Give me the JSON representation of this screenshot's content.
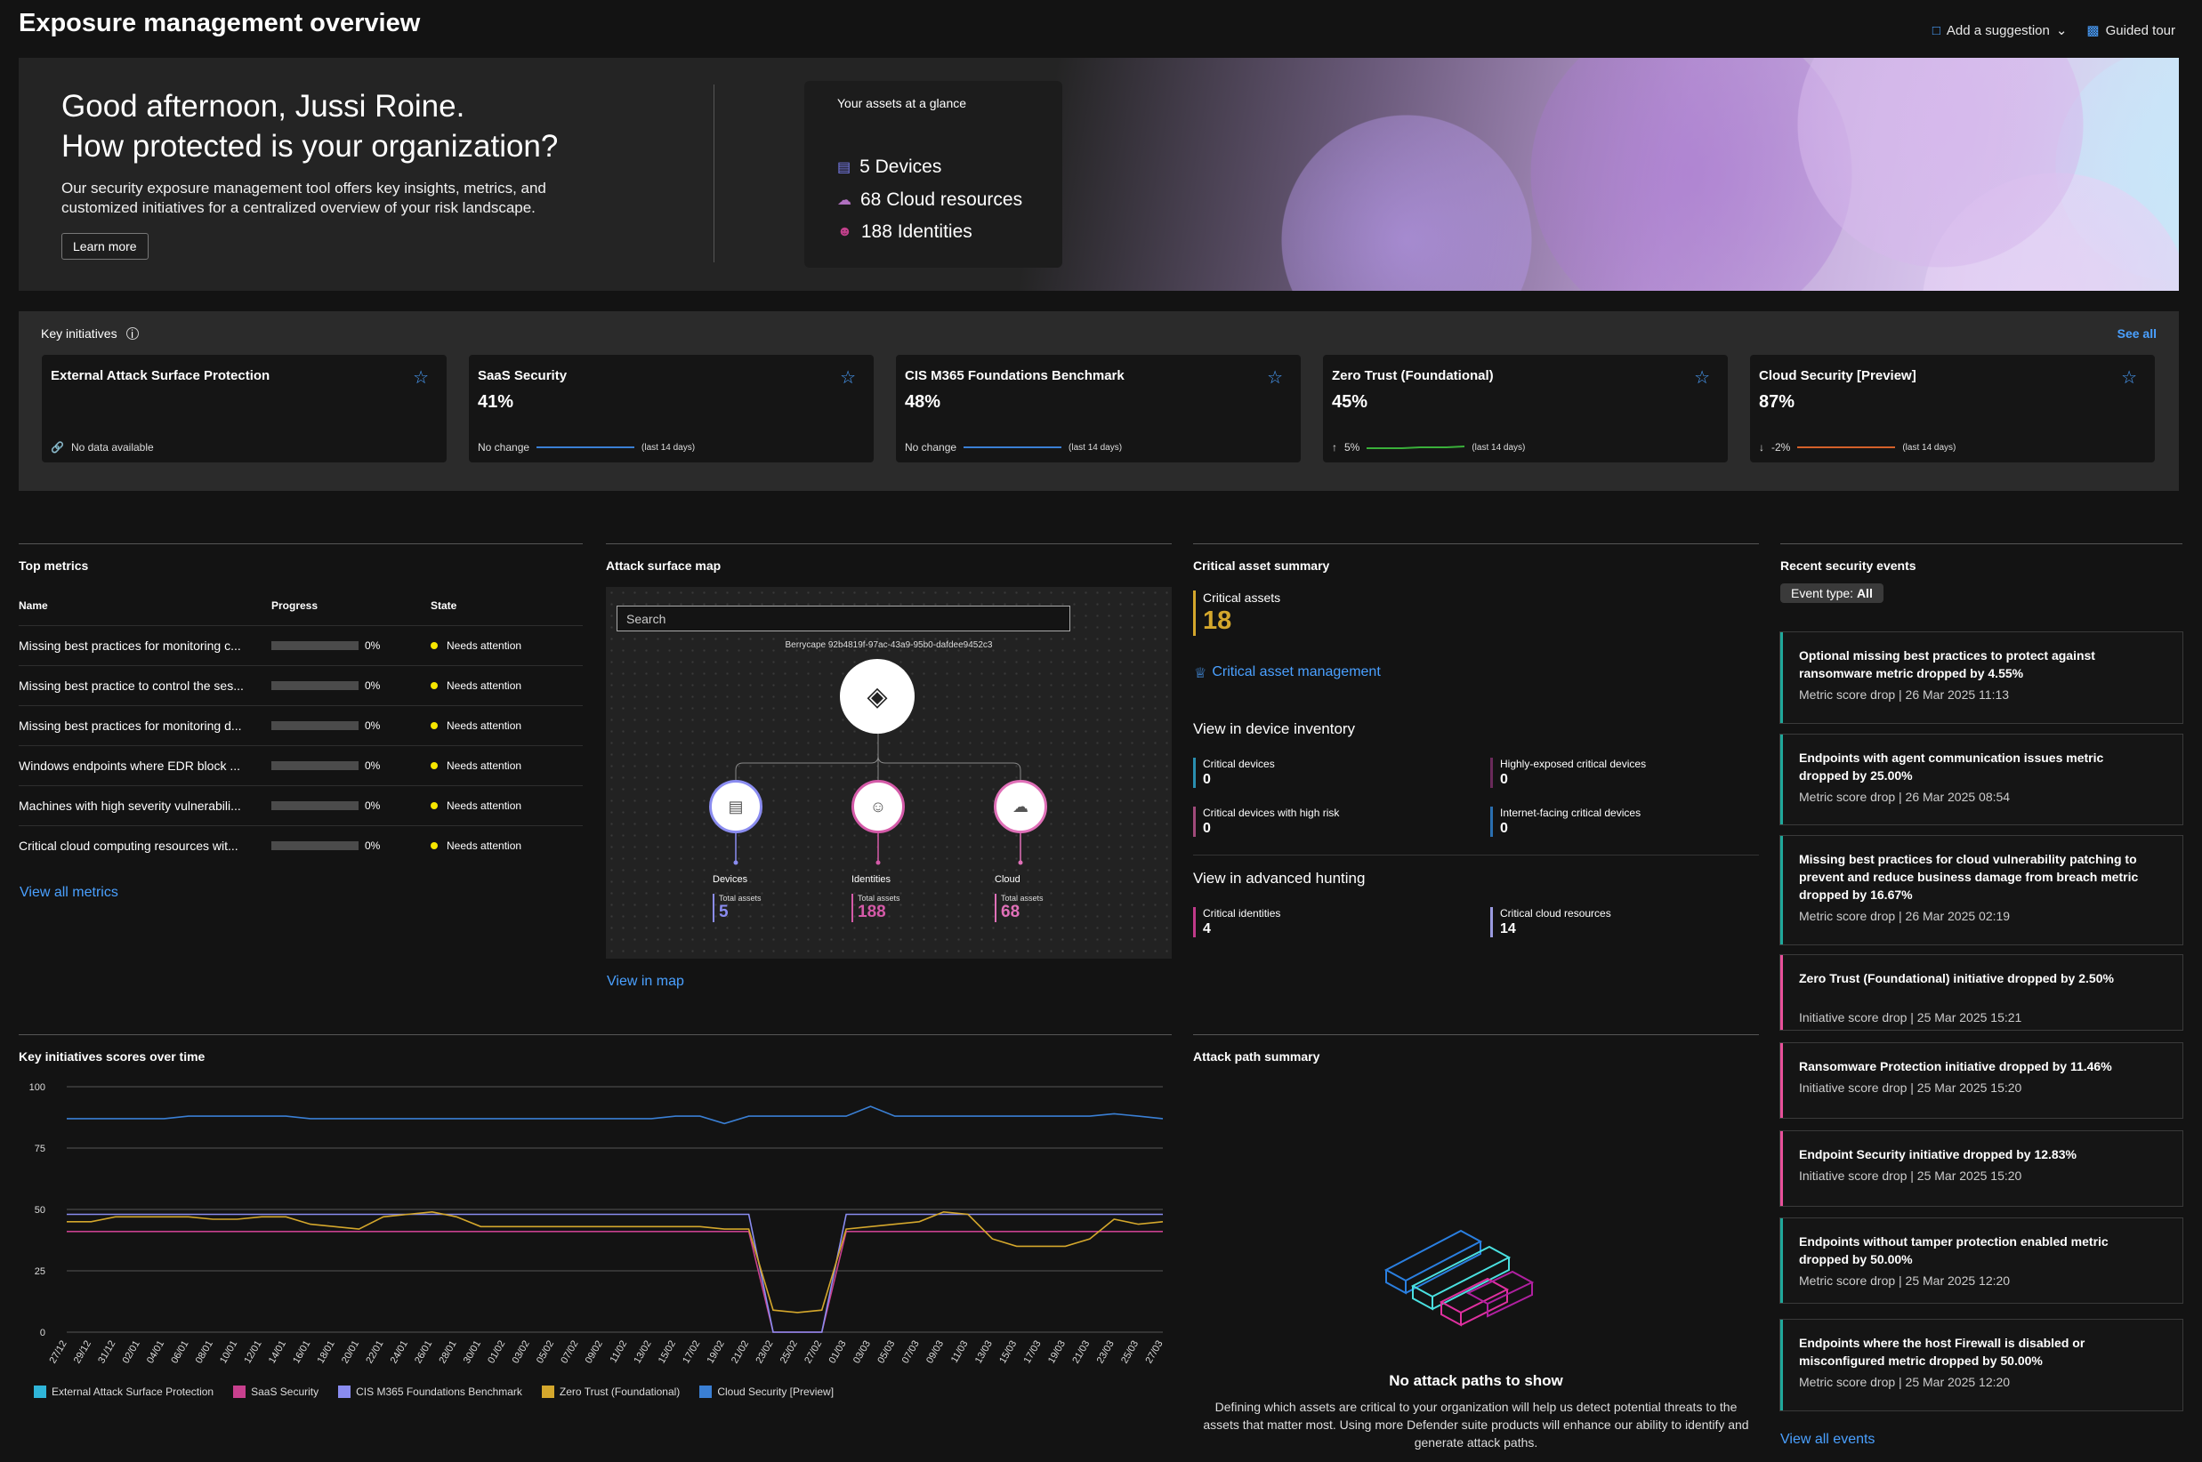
{
  "header": {
    "title": "Exposure management overview",
    "add_suggestion": "Add a suggestion",
    "guided_tour": "Guided tour"
  },
  "hero": {
    "greeting_line1": "Good afternoon, Jussi Roine.",
    "greeting_line2": "How protected is your organization?",
    "description": "Our security exposure management tool offers key insights, metrics, and customized initiatives for a centralized overview of your risk landscape.",
    "learn_more": "Learn more",
    "glance": {
      "title": "Your assets at a glance",
      "devices": "5  Devices",
      "cloud": "68  Cloud resources",
      "identities": "188  Identities"
    }
  },
  "key_initiatives": {
    "title": "Key initiatives",
    "see_all": "See all",
    "cards": [
      {
        "name": "External Attack Surface Protection",
        "pct": "",
        "change": "No data available",
        "period": ""
      },
      {
        "name": "SaaS Security",
        "pct": "41%",
        "change": "No change",
        "period": "(last 14 days)"
      },
      {
        "name": "CIS M365 Foundations Benchmark",
        "pct": "48%",
        "change": "No change",
        "period": "(last 14 days)"
      },
      {
        "name": "Zero Trust (Foundational)",
        "pct": "45%",
        "change": "5%",
        "period": "(last 14 days)"
      },
      {
        "name": "Cloud Security [Preview]",
        "pct": "87%",
        "change": "-2%",
        "period": "(last 14 days)"
      }
    ]
  },
  "top_metrics": {
    "title": "Top metrics",
    "col_name": "Name",
    "col_progress": "Progress",
    "col_state": "State",
    "rows": [
      {
        "name": "Missing best practices for monitoring c...",
        "progress": "0%",
        "state": "Needs attention"
      },
      {
        "name": "Missing best practice to control the ses...",
        "progress": "0%",
        "state": "Needs attention"
      },
      {
        "name": "Missing best practices for monitoring d...",
        "progress": "0%",
        "state": "Needs attention"
      },
      {
        "name": "Windows endpoints where EDR block ...",
        "progress": "0%",
        "state": "Needs attention"
      },
      {
        "name": "Machines with high severity vulnerabili...",
        "progress": "0%",
        "state": "Needs attention"
      },
      {
        "name": "Critical cloud computing resources wit...",
        "progress": "0%",
        "state": "Needs attention"
      }
    ],
    "view_all": "View all metrics"
  },
  "attack_surface": {
    "title": "Attack surface map",
    "search_placeholder": "Search",
    "tenant": "Berrycape 92b4819f-97ac-43a9-95b0-dafdee9452c3",
    "nodes": [
      {
        "label": "Devices",
        "total_label": "Total assets",
        "value": "5",
        "color": "#8a8cf0"
      },
      {
        "label": "Identities",
        "total_label": "Total assets",
        "value": "188",
        "color": "#d45aa8"
      },
      {
        "label": "Cloud",
        "total_label": "Total assets",
        "value": "68",
        "color": "#e070b8"
      }
    ],
    "view_in_map": "View in map"
  },
  "critical_assets": {
    "title": "Critical asset summary",
    "label": "Critical assets",
    "value": "18",
    "management_link": "Critical asset management",
    "device_inventory_title": "View in device inventory",
    "device_items": [
      {
        "label": "Critical devices",
        "value": "0",
        "color": "#2a8fb0"
      },
      {
        "label": "Highly-exposed critical devices",
        "value": "0",
        "color": "#6a2a5a"
      },
      {
        "label": "Critical devices with high risk",
        "value": "0",
        "color": "#a04a7a"
      },
      {
        "label": "Internet-facing critical devices",
        "value": "0",
        "color": "#2a6fb0"
      }
    ],
    "hunting_title": "View in advanced hunting",
    "hunting_items": [
      {
        "label": "Critical identities",
        "value": "4",
        "color": "#c03a8a"
      },
      {
        "label": "Critical cloud resources",
        "value": "14",
        "color": "#9a9ae0"
      }
    ]
  },
  "events": {
    "title": "Recent security events",
    "filter_label": "Event type:",
    "filter_value": "All",
    "items": [
      {
        "title": "Optional missing best practices to protect against ransomware metric dropped by 4.55%",
        "meta": "Metric score drop | 26 Mar 2025 11:13",
        "color": "#1fa89a"
      },
      {
        "title": "Endpoints with agent communication issues metric dropped by 25.00%",
        "meta": "Metric score drop | 26 Mar 2025 08:54",
        "color": "#1fa89a"
      },
      {
        "title": "Missing best practices for cloud vulnerability patching to prevent and reduce business damage from breach metric dropped by 16.67%",
        "meta": "Metric score drop | 26 Mar 2025 02:19",
        "color": "#1fa89a"
      },
      {
        "title": "Zero Trust (Foundational) initiative dropped by 2.50%",
        "meta": "Initiative score drop | 25 Mar 2025 15:21",
        "color": "#e8509a"
      },
      {
        "title": "Ransomware Protection initiative dropped by 11.46%",
        "meta": "Initiative score drop | 25 Mar 2025 15:20",
        "color": "#e8509a"
      },
      {
        "title": "Endpoint Security initiative dropped by 12.83%",
        "meta": "Initiative score drop | 25 Mar 2025 15:20",
        "color": "#e8509a"
      },
      {
        "title": "Endpoints without tamper protection enabled metric dropped by 50.00%",
        "meta": "Metric score drop | 25 Mar 2025 12:20",
        "color": "#1fa89a"
      },
      {
        "title": "Endpoints where the host Firewall is disabled or misconfigured metric dropped by 50.00%",
        "meta": "Metric score drop | 25 Mar 2025 12:20",
        "color": "#1fa89a"
      }
    ],
    "view_all": "View all events"
  },
  "attack_paths": {
    "title": "Attack path summary",
    "empty_title": "No attack paths to show",
    "empty_desc": "Defining which assets are critical to your organization will help us detect potential threats to the assets that matter most. Using more Defender suite products will enhance our ability to identify and generate attack paths."
  },
  "chart_data": {
    "type": "line",
    "title": "Key initiatives scores over time",
    "ylim": [
      0,
      100
    ],
    "yticks": [
      0,
      25,
      50,
      75,
      100
    ],
    "categories": [
      "27/12",
      "29/12",
      "31/12",
      "02/01",
      "04/01",
      "06/01",
      "08/01",
      "10/01",
      "12/01",
      "14/01",
      "16/01",
      "18/01",
      "20/01",
      "22/01",
      "24/01",
      "26/01",
      "28/01",
      "30/01",
      "01/02",
      "03/02",
      "05/02",
      "07/02",
      "09/02",
      "11/02",
      "13/02",
      "15/02",
      "17/02",
      "19/02",
      "21/02",
      "23/02",
      "25/02",
      "27/02",
      "01/03",
      "03/03",
      "05/03",
      "07/03",
      "09/03",
      "11/03",
      "13/03",
      "15/03",
      "17/03",
      "19/03",
      "21/03",
      "23/03",
      "25/03",
      "27/03"
    ],
    "series": [
      {
        "name": "External Attack Surface Protection",
        "color": "#2fb5d8",
        "values": []
      },
      {
        "name": "SaaS Security",
        "color": "#c8408e",
        "values": [
          41,
          41,
          41,
          41,
          41,
          41,
          41,
          41,
          41,
          41,
          41,
          41,
          41,
          41,
          41,
          41,
          41,
          41,
          41,
          41,
          41,
          41,
          41,
          41,
          41,
          41,
          41,
          41,
          41,
          0,
          0,
          0,
          41,
          41,
          41,
          41,
          41,
          41,
          41,
          41,
          41,
          41,
          41,
          41,
          41,
          41
        ]
      },
      {
        "name": "CIS M365 Foundations Benchmark",
        "color": "#8a8cf0",
        "values": [
          48,
          48,
          48,
          48,
          48,
          48,
          48,
          48,
          48,
          48,
          48,
          48,
          48,
          48,
          48,
          48,
          48,
          48,
          48,
          48,
          48,
          48,
          48,
          48,
          48,
          48,
          48,
          48,
          48,
          0,
          0,
          0,
          48,
          48,
          48,
          48,
          48,
          48,
          48,
          48,
          48,
          48,
          48,
          48,
          48,
          48
        ]
      },
      {
        "name": "Zero Trust (Foundational)",
        "color": "#d4a72c",
        "values": [
          45,
          45,
          47,
          47,
          47,
          47,
          46,
          46,
          47,
          47,
          44,
          43,
          42,
          47,
          48,
          49,
          47,
          43,
          43,
          43,
          43,
          43,
          43,
          43,
          43,
          43,
          43,
          42,
          42,
          9,
          8,
          9,
          42,
          43,
          44,
          45,
          49,
          48,
          38,
          35,
          35,
          35,
          38,
          46,
          44,
          45
        ]
      },
      {
        "name": "Cloud Security [Preview]",
        "color": "#3a7fd4",
        "values": [
          87,
          87,
          87,
          87,
          87,
          88,
          88,
          88,
          88,
          88,
          87,
          87,
          87,
          87,
          87,
          87,
          87,
          87,
          87,
          87,
          87,
          87,
          87,
          87,
          87,
          88,
          88,
          85,
          88,
          88,
          88,
          88,
          88,
          92,
          88,
          88,
          88,
          88,
          88,
          88,
          88,
          88,
          88,
          89,
          88,
          87
        ]
      }
    ]
  }
}
